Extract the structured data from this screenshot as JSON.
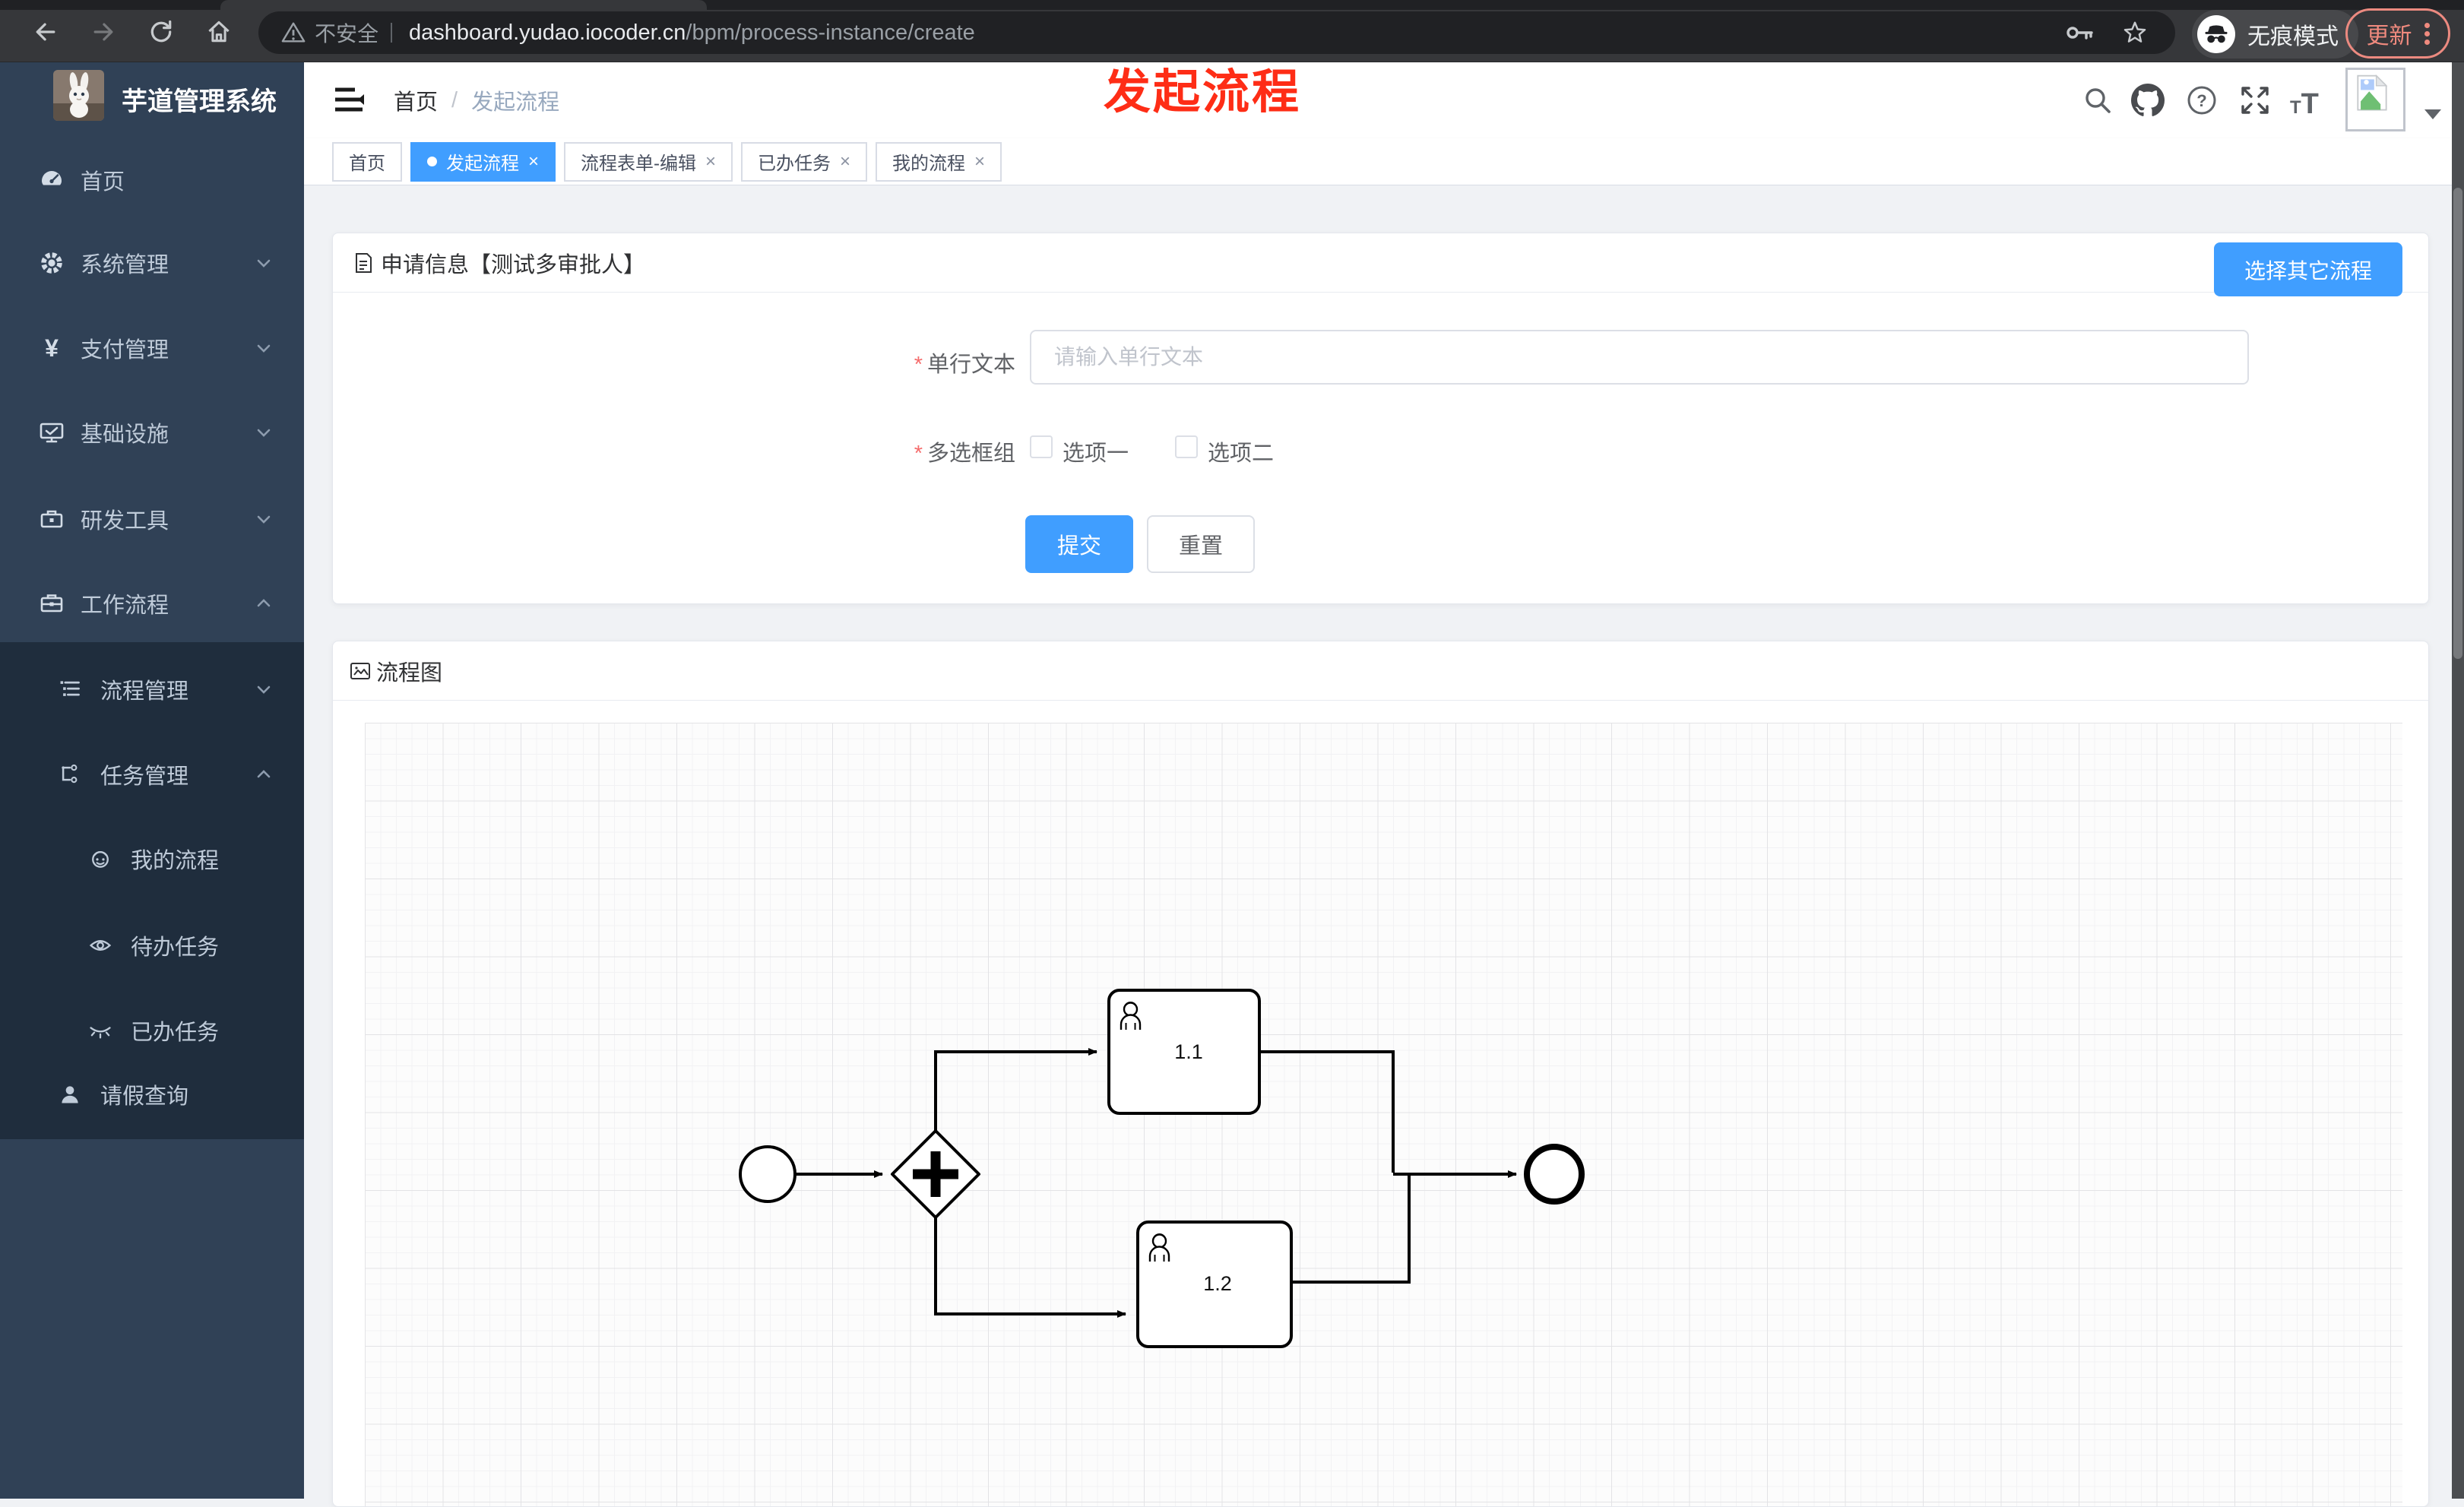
{
  "browser": {
    "security_label": "不安全",
    "url_host": "dashboard.yudao.iocoder.cn",
    "url_path": "/bpm/process-instance/create",
    "incognito_label": "无痕模式",
    "update_label": "更新"
  },
  "sidebar": {
    "app_title": "芋道管理系统",
    "items": [
      {
        "label": "首页",
        "icon": "gauge-icon"
      },
      {
        "label": "系统管理",
        "icon": "gear-icon",
        "chevron": "down"
      },
      {
        "label": "支付管理",
        "icon": "yen-icon",
        "chevron": "down"
      },
      {
        "label": "基础设施",
        "icon": "monitor-icon",
        "chevron": "down"
      },
      {
        "label": "研发工具",
        "icon": "toolbox-icon",
        "chevron": "down"
      },
      {
        "label": "工作流程",
        "icon": "briefcase-icon",
        "chevron": "up"
      }
    ],
    "submenu": [
      {
        "label": "流程管理",
        "icon": "list-tree-icon",
        "chevron": "down"
      },
      {
        "label": "任务管理",
        "icon": "org-tree-icon",
        "chevron": "up"
      },
      {
        "label": "我的流程",
        "icon": "face-icon"
      },
      {
        "label": "待办任务",
        "icon": "eye-icon"
      },
      {
        "label": "已办任务",
        "icon": "eye-closed-icon"
      },
      {
        "label": "请假查询",
        "icon": "user-icon"
      }
    ]
  },
  "header": {
    "breadcrumb": {
      "home": "首页",
      "separator": "/",
      "current": "发起流程"
    }
  },
  "tabs": {
    "close_glyph": "×",
    "items": [
      {
        "label": "首页",
        "active": false,
        "closable": false
      },
      {
        "label": "发起流程",
        "active": true,
        "closable": true
      },
      {
        "label": "流程表单-编辑",
        "active": false,
        "closable": true
      },
      {
        "label": "已办任务",
        "active": false,
        "closable": true
      },
      {
        "label": "我的流程",
        "active": false,
        "closable": true
      }
    ]
  },
  "annotation": {
    "text": "发起流程",
    "color": "#fe2d16"
  },
  "form_card": {
    "title": "申请信息【测试多审批人】",
    "choose_button": "选择其它流程",
    "fields": [
      {
        "label": "单行文本",
        "required": "*",
        "placeholder": "请输入单行文本",
        "value": ""
      },
      {
        "label": "多选框组",
        "required": "*",
        "options": [
          "选项一",
          "选项二"
        ],
        "checked": [
          false,
          false
        ]
      }
    ],
    "submit_label": "提交",
    "reset_label": "重置"
  },
  "diagram_card": {
    "title": "流程图",
    "bpmn": {
      "type": "process-diagram",
      "gateway": "parallel",
      "task1_label": "1.1",
      "task2_label": "1.2"
    }
  },
  "colors": {
    "primary": "#409eff",
    "sidebar_bg": "#304156",
    "submenu_bg": "#1f2d3d",
    "annotation_red": "#fe2d16",
    "chrome_toolbar": "#36373a",
    "update_coral": "#f08a7e"
  }
}
